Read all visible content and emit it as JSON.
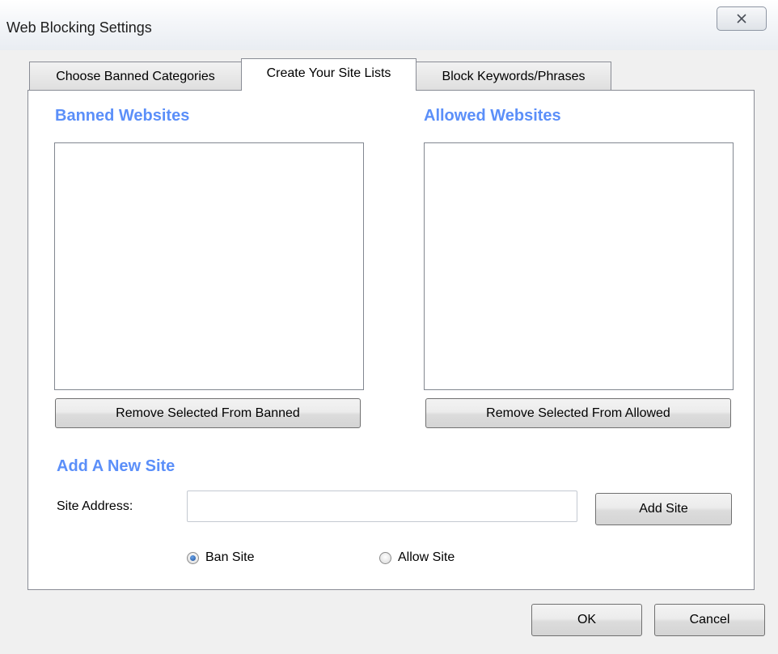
{
  "window": {
    "title": "Web Blocking Settings",
    "close_icon": "close-x-icon"
  },
  "tabs": [
    {
      "label": "Choose Banned Categories",
      "active": false
    },
    {
      "label": "Create Your Site Lists",
      "active": true
    },
    {
      "label": "Block Keywords/Phrases",
      "active": false
    }
  ],
  "banned": {
    "heading": "Banned Websites",
    "items": [],
    "remove_label": "Remove Selected From Banned"
  },
  "allowed": {
    "heading": "Allowed Websites",
    "items": [],
    "remove_label": "Remove Selected From Allowed"
  },
  "add_site": {
    "heading": "Add A New Site",
    "address_label": "Site Address:",
    "address_value": "",
    "add_button_label": "Add Site",
    "options": [
      {
        "label": "Ban Site",
        "selected": true
      },
      {
        "label": "Allow Site",
        "selected": false
      }
    ]
  },
  "footer": {
    "ok_label": "OK",
    "cancel_label": "Cancel"
  },
  "colors": {
    "heading_accent": "#5b8ff9",
    "window_bg": "#f0f0f0"
  }
}
